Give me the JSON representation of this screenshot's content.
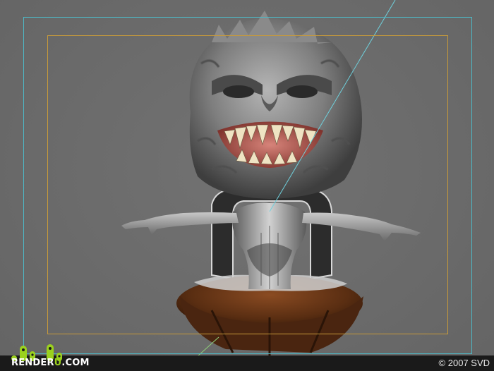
{
  "watermark": {
    "brand_prefix": "RENDER",
    "brand_accent": "U",
    "brand_suffix": ".COM",
    "accent_color": "#9bd11e"
  },
  "copyright": "© 2007 SVD",
  "viewport": {
    "background_color": "#6b6b6b",
    "safe_frame_outer_color": "#4fb7c4",
    "safe_frame_inner_color": "#c79a3a"
  },
  "subject": {
    "skin_color": "#8e8e8e",
    "base_color": "#5a2e12",
    "teeth_color": "#efe3c3",
    "mouth_color": "#c0635a"
  }
}
